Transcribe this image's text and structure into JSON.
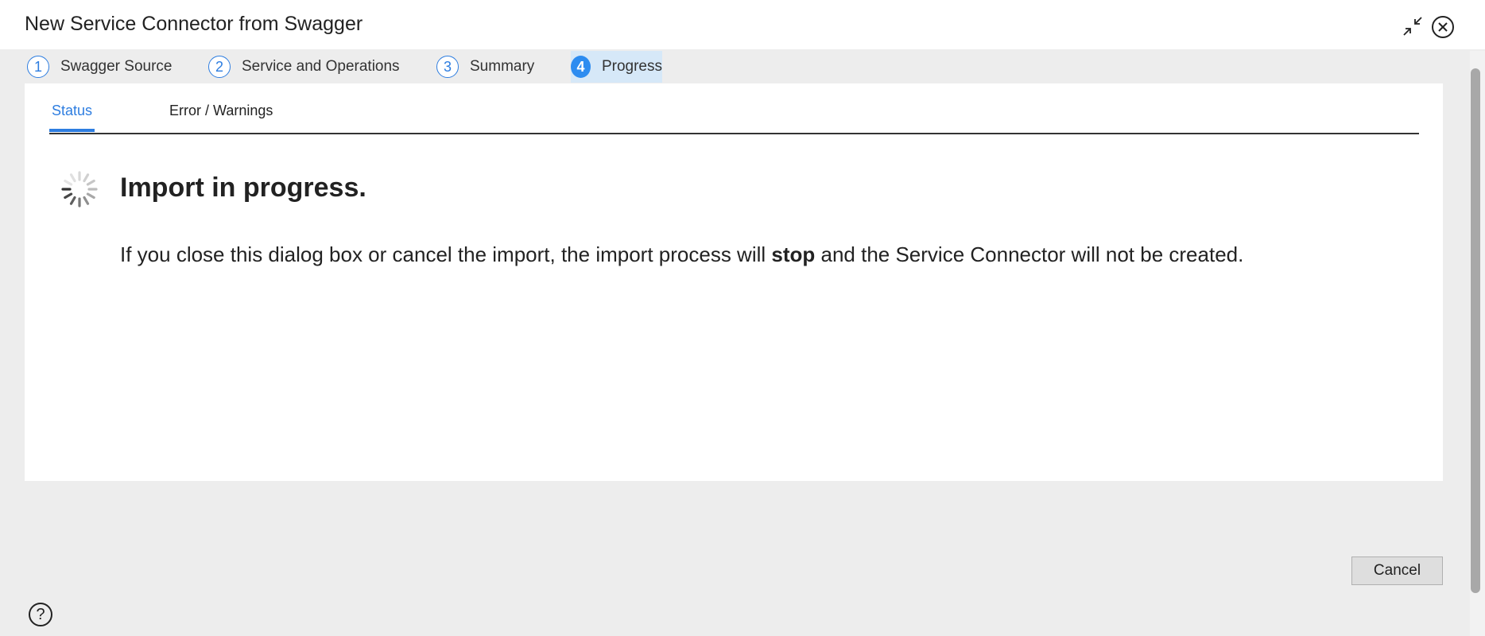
{
  "dialog": {
    "title": "New Service Connector from Swagger"
  },
  "steps": [
    {
      "number": "1",
      "label": "Swagger Source"
    },
    {
      "number": "2",
      "label": "Service and Operations"
    },
    {
      "number": "3",
      "label": "Summary"
    },
    {
      "number": "4",
      "label": "Progress",
      "active": true
    }
  ],
  "tabs": [
    {
      "label": "Status",
      "active": true
    },
    {
      "label": "Error / Warnings"
    }
  ],
  "status": {
    "title": "Import in progress.",
    "message_before": "If you close this dialog box or cancel the import, the import process will ",
    "message_bold": "stop",
    "message_after": " and the Service Connector will not be created."
  },
  "footer": {
    "cancel_label": "Cancel",
    "help_label": "?"
  },
  "icons": {
    "collapse": "collapse-icon",
    "close": "close-icon",
    "spinner": "spinner-icon",
    "help": "help-icon"
  },
  "colors": {
    "accent": "#2d7de0",
    "active_step_bg": "#d6e8f8",
    "dialog_bg": "#ededed"
  }
}
